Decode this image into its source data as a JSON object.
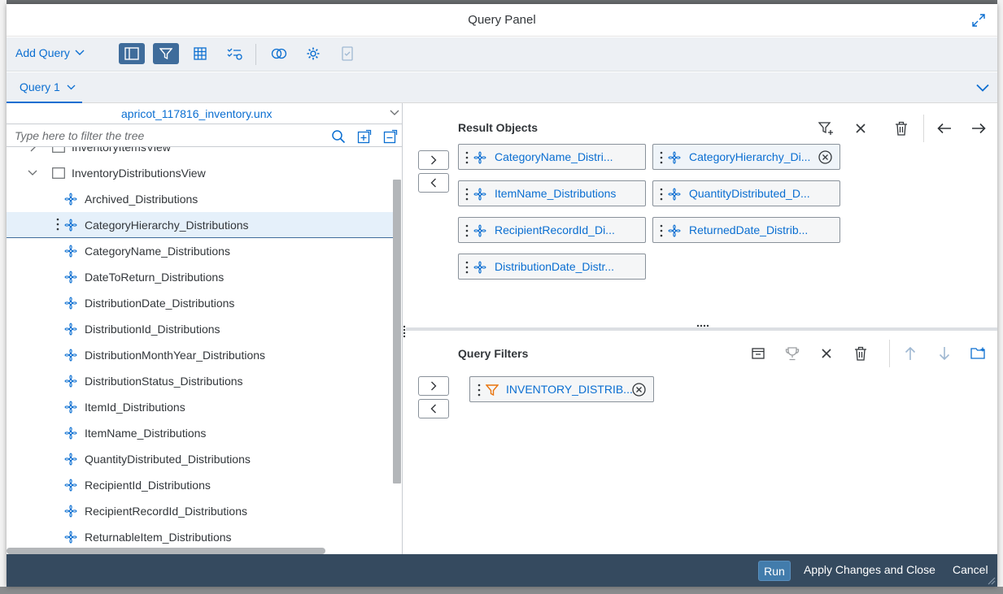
{
  "dialog": {
    "title": "Query Panel",
    "expand_icon": "fullscreen-icon"
  },
  "toolbar": {
    "add_query": "Add Query",
    "buttons": [
      "sidebar-toggle-icon",
      "filter-icon",
      "table-icon",
      "data-preview-icon",
      "combine-queries-icon",
      "settings-icon",
      "sql-viewer-icon"
    ]
  },
  "tabs": [
    {
      "label": "Query 1"
    }
  ],
  "universe": {
    "name": "apricot_117816_inventory.unx"
  },
  "tree_filter": {
    "placeholder": "Type here to filter the tree"
  },
  "tree": {
    "folders": [
      {
        "label": "InventoryItemsView"
      },
      {
        "label": "InventoryDistributionsView"
      }
    ],
    "items": [
      {
        "label": "Archived_Distributions"
      },
      {
        "label": "CategoryHierarchy_Distributions"
      },
      {
        "label": "CategoryName_Distributions"
      },
      {
        "label": "DateToReturn_Distributions"
      },
      {
        "label": "DistributionDate_Distributions"
      },
      {
        "label": "DistributionId_Distributions"
      },
      {
        "label": "DistributionMonthYear_Distributions"
      },
      {
        "label": "DistributionStatus_Distributions"
      },
      {
        "label": "ItemId_Distributions"
      },
      {
        "label": "ItemName_Distributions"
      },
      {
        "label": "QuantityDistributed_Distributions"
      },
      {
        "label": "RecipientId_Distributions"
      },
      {
        "label": "RecipientRecordId_Distributions"
      },
      {
        "label": "ReturnableItem_Distributions"
      }
    ],
    "selected_item": "CategoryHierarchy_Distributions"
  },
  "result_objects": {
    "title": "Result Objects",
    "chips": [
      {
        "label": "CategoryName_Distri..."
      },
      {
        "label": "CategoryHierarchy_Di..."
      },
      {
        "label": "ItemName_Distributions"
      },
      {
        "label": "QuantityDistributed_D..."
      },
      {
        "label": "RecipientRecordId_Di..."
      },
      {
        "label": "ReturnedDate_Distrib..."
      },
      {
        "label": "DistributionDate_Distr..."
      }
    ]
  },
  "query_filters": {
    "title": "Query Filters",
    "chips": [
      {
        "label": "INVENTORY_DISTRIB..."
      }
    ]
  },
  "footer": {
    "run": "Run",
    "apply": "Apply Changes and Close",
    "cancel": "Cancel"
  },
  "colors": {
    "accent": "#0a6ed1",
    "active_toggle": "#3f6c9b",
    "footer": "#354a5f",
    "filter_icon": "#e9730c"
  }
}
